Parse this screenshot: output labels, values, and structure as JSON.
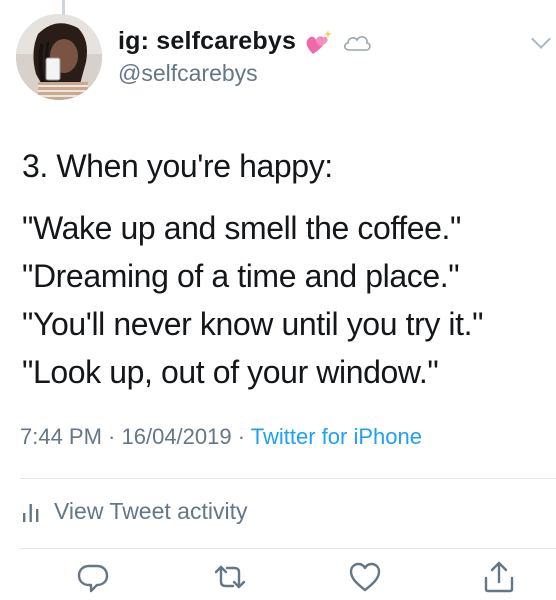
{
  "author": {
    "display_name": "ig: selfcarebys",
    "handle": "@selfcarebys",
    "emoji_icons": [
      "sparkling-heart-icon",
      "cloud-icon"
    ]
  },
  "tweet": {
    "heading": "3. When you're happy:",
    "lines": [
      "\"Wake up and smell the coffee.\"",
      "\"Dreaming of a time and place.\"",
      "\"You'll never know until you try it.\"",
      "\"Look up, out of your window.\""
    ]
  },
  "meta": {
    "time": "7:44 PM",
    "separator": " · ",
    "date": "16/04/2019",
    "source": "Twitter for iPhone"
  },
  "activity": {
    "label": "View Tweet activity",
    "icon": "bar-chart-icon"
  },
  "actions": {
    "icons": [
      "reply-icon",
      "retweet-icon",
      "like-icon",
      "share-icon"
    ]
  },
  "colors": {
    "link": "#1da1f2",
    "secondary_text": "#657786",
    "primary_text": "#14171a",
    "divider": "#e1e8ed",
    "heart": "#e0245e"
  }
}
